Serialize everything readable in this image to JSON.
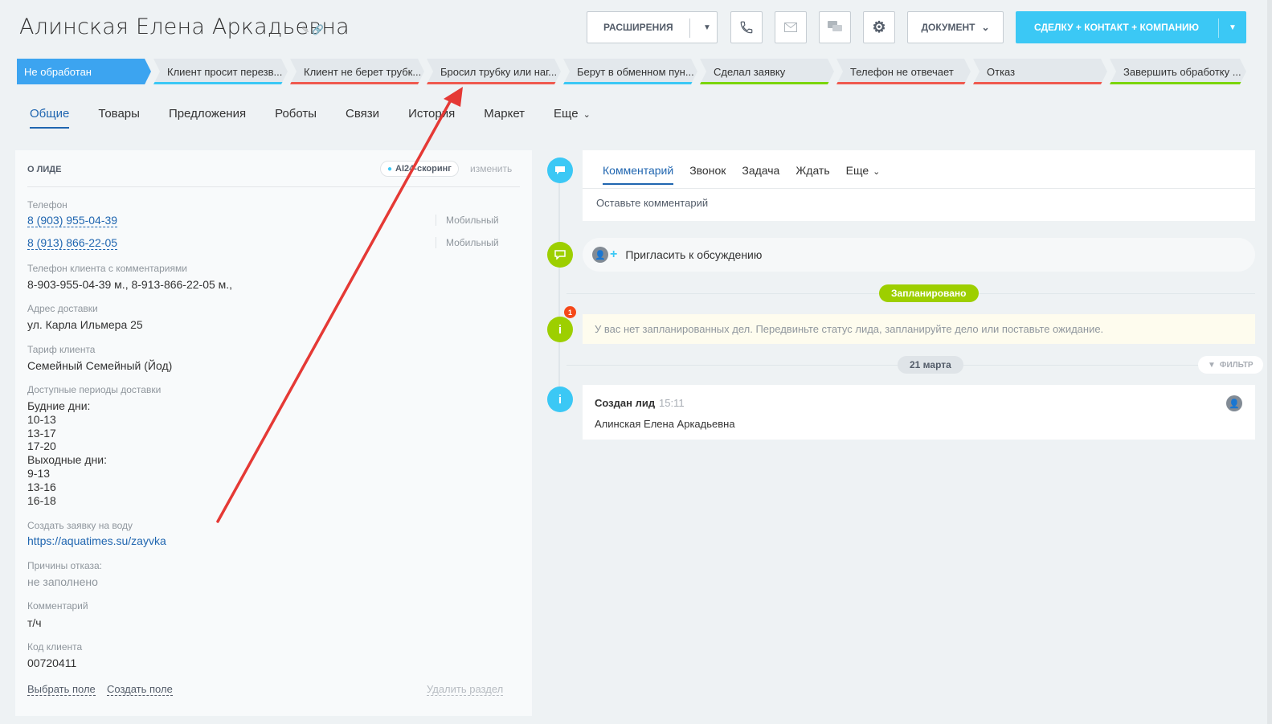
{
  "header": {
    "title": "Алинская Елена  Аркадьевна",
    "extensions_label": "РАСШИРЕНИЯ",
    "document_label": "ДОКУМЕНТ",
    "deal_button_label": "СДЕЛКУ + КОНТАКТ + КОМПАНИЮ"
  },
  "stages": [
    {
      "label": "Не обработан",
      "bar": "#3ca4f0"
    },
    {
      "label": "Клиент просит перезв...",
      "bar": "#3bc8f5"
    },
    {
      "label": "Клиент не берет трубк...",
      "bar": "#ef5a4f"
    },
    {
      "label": "Бросил трубку или наг...",
      "bar": "#ef5a4f"
    },
    {
      "label": "Берут в обменном пун...",
      "bar": "#3bc8f5"
    },
    {
      "label": "Сделал заявку",
      "bar": "#7bd500"
    },
    {
      "label": "Телефон не отвечает",
      "bar": "#ef5a4f"
    },
    {
      "label": "Отказ",
      "bar": "#ef5a4f"
    },
    {
      "label": "Завершить обработку ...",
      "bar": "#7bd500"
    }
  ],
  "tabs": [
    "Общие",
    "Товары",
    "Предложения",
    "Роботы",
    "Связи",
    "История",
    "Маркет",
    "Еще"
  ],
  "panel": {
    "heading": "О ЛИДЕ",
    "ai_badge": "AI24-скоринг",
    "edit_label": "изменить",
    "phone_label": "Телефон",
    "phones": [
      {
        "number": "8 (903) 955-04-39",
        "type": "Мобильный"
      },
      {
        "number": "8 (913) 866-22-05",
        "type": "Мобильный"
      }
    ],
    "phone_comment_label": "Телефон клиента с комментариями",
    "phone_comment_value": "8-903-955-04-39 м., 8-913-866-22-05 м.,",
    "address_label": "Адрес доставки",
    "address_value": "ул. Карла Ильмера 25",
    "tariff_label": "Тариф клиента",
    "tariff_value": "Семейный Семейный (Йод)",
    "periods_label": "Доступные периоды доставки",
    "periods_lines": [
      "Будние дни:",
      "10-13",
      "13-17",
      "17-20",
      "Выходные дни:",
      "9-13",
      "13-16",
      "16-18"
    ],
    "order_label": "Создать заявку на воду",
    "order_url": "https://aquatimes.su/zayvka",
    "refusal_label": "Причины отказа:",
    "refusal_value": "не заполнено",
    "comment_label": "Комментарий",
    "comment_value": "т/ч",
    "client_code_label": "Код клиента",
    "client_code_value": "00720411",
    "choose_field": "Выбрать поле",
    "create_field": "Создать поле",
    "delete_section": "Удалить раздел"
  },
  "timeline": {
    "comment_tabs": [
      "Комментарий",
      "Звонок",
      "Задача",
      "Ждать",
      "Еще"
    ],
    "comment_placeholder": "Оставьте комментарий",
    "invite_text": "Пригласить к обсуждению",
    "planned_label": "Запланировано",
    "notification_count": "1",
    "no_tasks_text": "У вас нет запланированных дел. Передвиньте статус лида, запланируйте дело или поставьте ожидание.",
    "date_label": "21 марта",
    "filter_label": "ФИЛЬТР",
    "event_title": "Создан лид",
    "event_time": "15:11",
    "event_text": "Алинская Елена Аркадьевна"
  },
  "colors": {
    "accent": "#3bc8f5",
    "link": "#2066b0",
    "annotation_arrow": "#e53935"
  }
}
